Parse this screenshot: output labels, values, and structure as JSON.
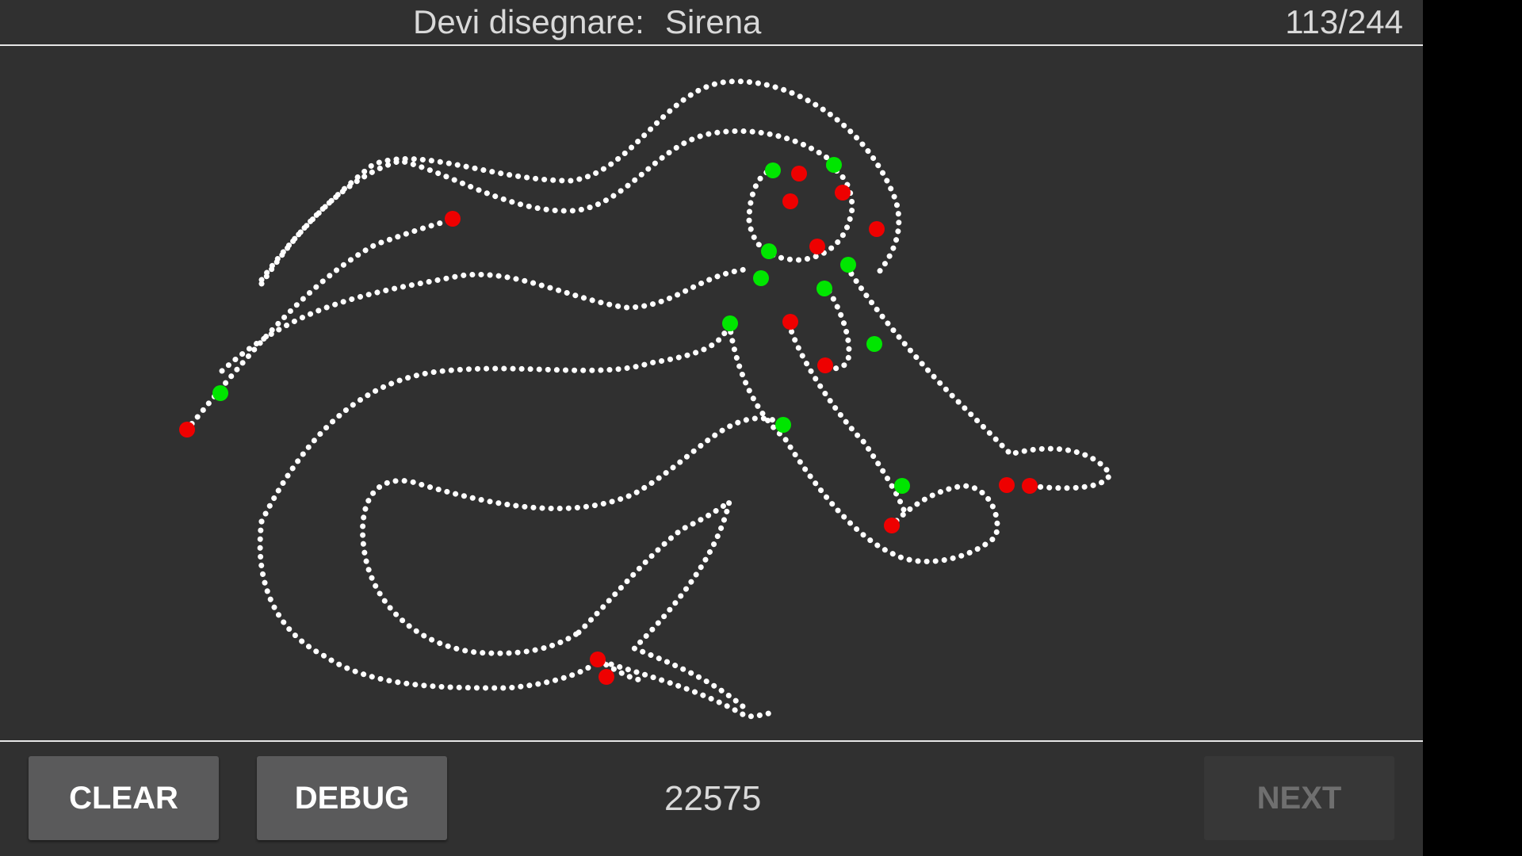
{
  "header": {
    "prompt_label": "Devi disegnare:",
    "prompt_subject": "Sirena",
    "counter": "113/244"
  },
  "toolbar": {
    "clear_label": "CLEAR",
    "debug_label": "DEBUG",
    "score": "22575",
    "next_label": "NEXT"
  },
  "colors": {
    "background": "#303030",
    "stroke": "#ffffff",
    "stroke_start": "#00e600",
    "stroke_end": "#ee0000"
  }
}
